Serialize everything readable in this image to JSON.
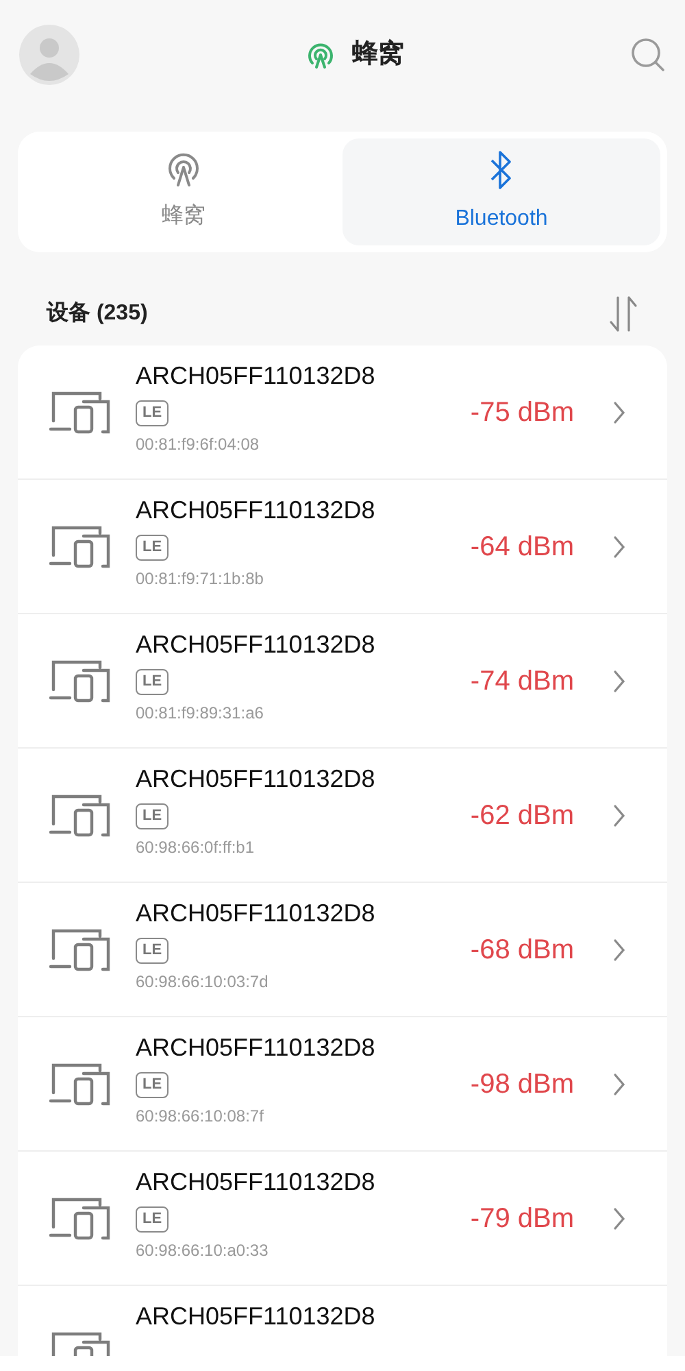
{
  "header": {
    "title": "蜂窝"
  },
  "tabs": [
    {
      "label": "蜂窝",
      "kind": "cellular",
      "selected": false
    },
    {
      "label": "Bluetooth",
      "kind": "bluetooth",
      "selected": true
    }
  ],
  "section": {
    "title": "设备 (235)"
  },
  "devices": [
    {
      "name": "ARCH05FF110132D8",
      "tag": "LE",
      "address": "00:81:f9:6f:04:08",
      "rssi": "-75 dBm"
    },
    {
      "name": "ARCH05FF110132D8",
      "tag": "LE",
      "address": "00:81:f9:71:1b:8b",
      "rssi": "-64 dBm"
    },
    {
      "name": "ARCH05FF110132D8",
      "tag": "LE",
      "address": "00:81:f9:89:31:a6",
      "rssi": "-74 dBm"
    },
    {
      "name": "ARCH05FF110132D8",
      "tag": "LE",
      "address": "60:98:66:0f:ff:b1",
      "rssi": "-62 dBm"
    },
    {
      "name": "ARCH05FF110132D8",
      "tag": "LE",
      "address": "60:98:66:10:03:7d",
      "rssi": "-68 dBm"
    },
    {
      "name": "ARCH05FF110132D8",
      "tag": "LE",
      "address": "60:98:66:10:08:7f",
      "rssi": "-98 dBm"
    },
    {
      "name": "ARCH05FF110132D8",
      "tag": "LE",
      "address": "60:98:66:10:a0:33",
      "rssi": "-79 dBm"
    },
    {
      "name": "ARCH05FF110132D8"
    }
  ]
}
